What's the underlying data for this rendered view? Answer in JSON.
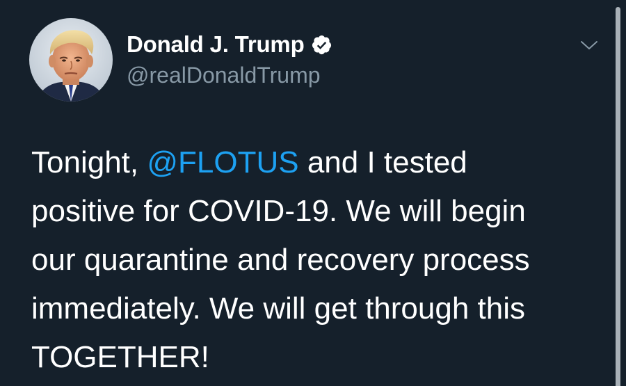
{
  "tweet": {
    "author": {
      "display_name": "Donald J. Trump",
      "handle": "@realDonaldTrump",
      "verified": true,
      "avatar_icon": "profile-photo"
    },
    "menu_icon": "chevron-down-icon",
    "text_lines": [
      {
        "before": "Tonight, ",
        "mention": "@FLOTUS",
        "after": " and I tested"
      },
      {
        "text": "positive for COVID-19. We will begin"
      },
      {
        "text": "our quarantine and recovery process"
      },
      {
        "text": "immediately. We will get through this"
      },
      {
        "text": "TOGETHER!"
      }
    ]
  },
  "colors": {
    "background": "#15202b",
    "text": "#ffffff",
    "secondary_text": "#8899a6",
    "mention": "#1da1f2",
    "scrollbar": "#a9b1b8"
  }
}
